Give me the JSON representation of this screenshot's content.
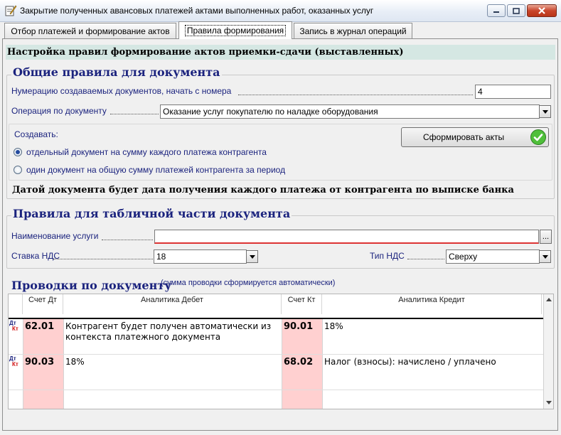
{
  "window": {
    "title": "Закрытие полученных авансовых платежей актами выполненных работ, оказанных услуг"
  },
  "tabs": [
    {
      "label": "Отбор платежей и формирование актов"
    },
    {
      "label": "Правила формирования"
    },
    {
      "label": "Запись в журнал операций"
    }
  ],
  "header": "Настройка правил формирование актов приемки-сдачи (выставленных)",
  "general": {
    "title": "Общие правила для документа",
    "numbering_label": "Нумерацию создаваемых документов, начать с номера",
    "numbering_value": "4",
    "operation_label": "Операция по документу",
    "operation_value": "Оказание услуг покупателю по наладке оборудования",
    "create_label": "Создавать:",
    "radio_options": [
      {
        "label": "отдельный документ на сумму каждого платежа контрагента",
        "checked": true
      },
      {
        "label": "один документ на общую сумму платежей контрагента за период",
        "checked": false
      }
    ],
    "generate_button": "Сформировать акты",
    "date_note": "Датой документа будет дата получения каждого платежа от контрагента по выписке банка"
  },
  "table_rules": {
    "title": "Правила для табличной части документа",
    "service_label": "Наименование услуги",
    "service_value": "",
    "service_button": "...",
    "vat_rate_label": "Ставка НДС",
    "vat_rate_value": "18",
    "vat_type_label": "Тип НДС",
    "vat_type_value": "Сверху"
  },
  "postings": {
    "title": "Проводки по документу",
    "subtitle": "(сумма проводки сформируется автоматически)",
    "columns": [
      "Счет Дт",
      "Аналитика Дебет",
      "Счет Кт",
      "Аналитика Кредит"
    ],
    "row_marker": {
      "dt": "Дт",
      "kt": "Кт"
    },
    "rows": [
      {
        "debit": "62.01",
        "debit_analytics": "Контрагент будет получен автоматически из контекста платежного документа",
        "credit": "90.01",
        "credit_analytics": "18%"
      },
      {
        "debit": "90.03",
        "debit_analytics": "18%",
        "credit": "68.02",
        "credit_analytics": "Налог (взносы): начислено / уплачено"
      }
    ]
  },
  "colors": {
    "accent_text": "#1b237e",
    "header_strip": "#d5e7e3",
    "account_cell": "#ffd0d0",
    "close_button": "#c9462c"
  }
}
